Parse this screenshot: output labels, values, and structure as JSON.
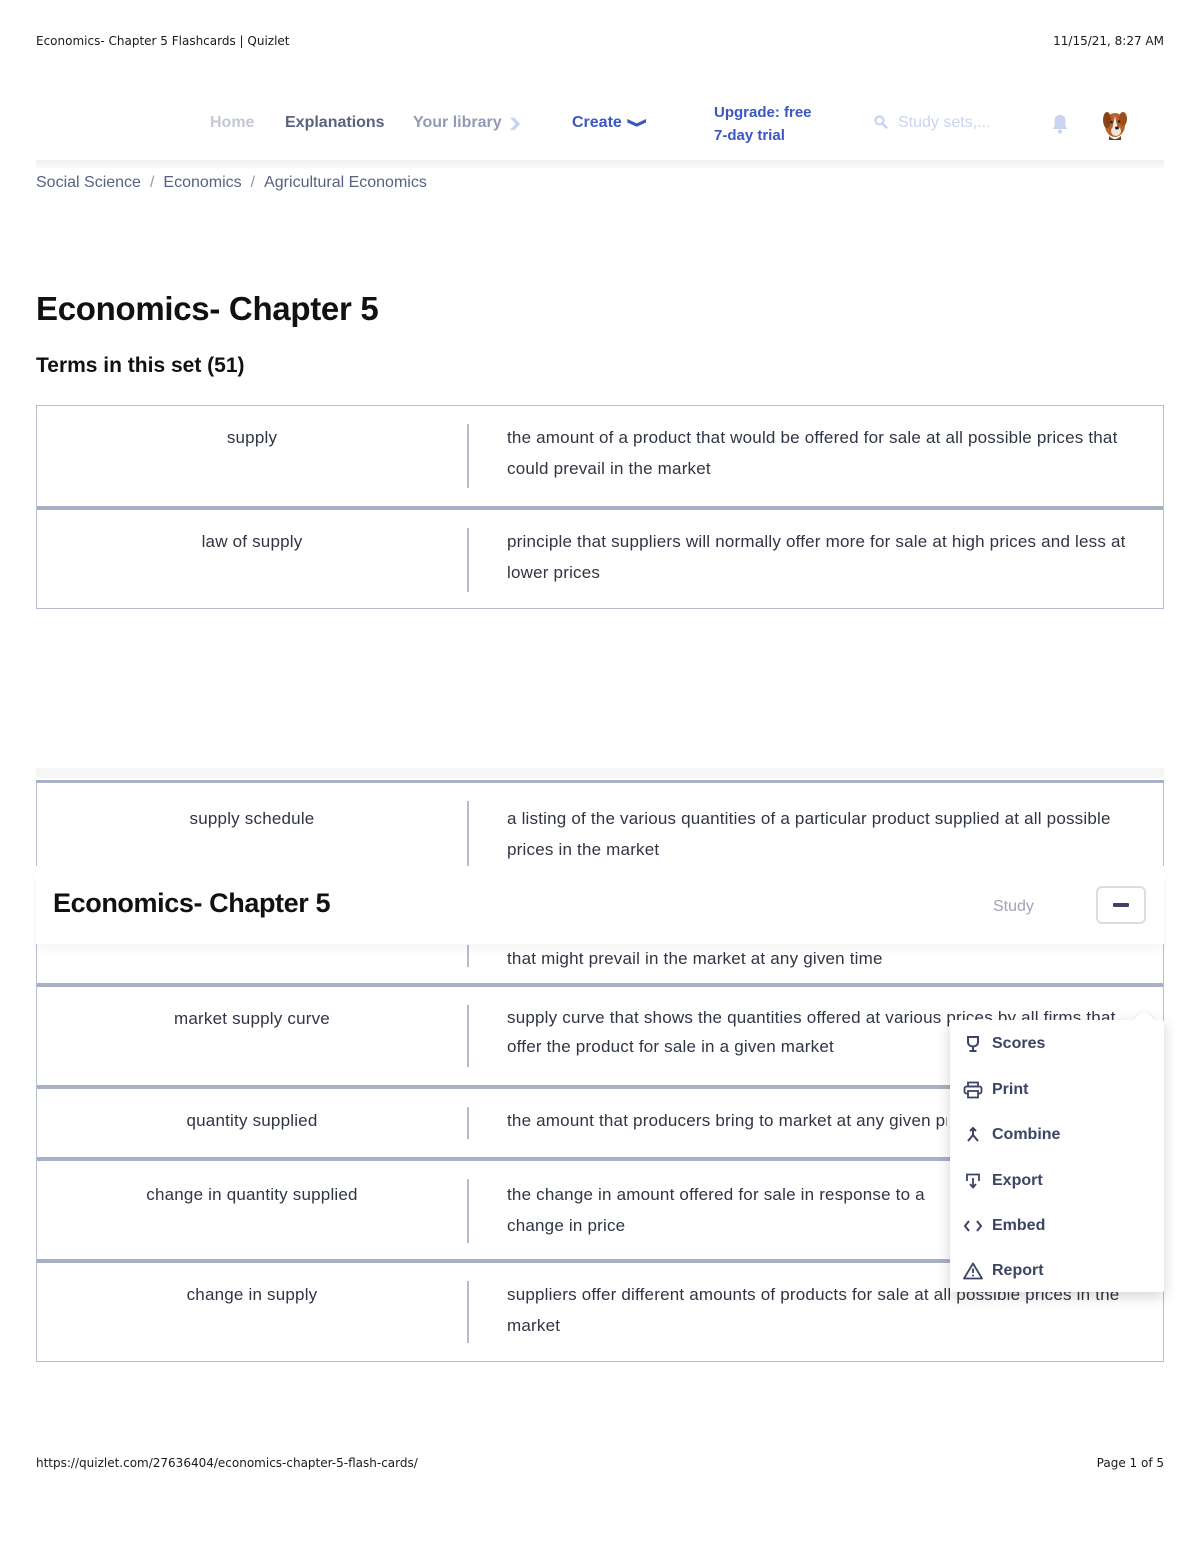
{
  "print_header": {
    "title": "Economics- Chapter 5 Flashcards | Quizlet",
    "datetime": "11/15/21, 8:27 AM"
  },
  "nav": {
    "home": "Home",
    "explanations": "Explanations",
    "your_library": "Your library",
    "create": "Create",
    "upgrade_line1": "Upgrade: free",
    "upgrade_line2": "7-day trial",
    "search_placeholder": "Study sets,...",
    "icons": {
      "search": "search-icon",
      "notifications": "bell-icon",
      "avatar": "dog-avatar"
    }
  },
  "breadcrumb": [
    "Social Science",
    "Economics",
    "Agricultural Economics"
  ],
  "breadcrumb_separator": "/",
  "set": {
    "title": "Economics- Chapter 5",
    "terms_heading": "Terms in this set (51)"
  },
  "terms_page1": [
    {
      "term": "supply",
      "definition": "the amount of a product that would be offered for sale at all possible prices that could prevail in the market"
    },
    {
      "term": "law of supply",
      "definition": "principle that suppliers will normally offer more for sale at high prices and less at lower prices"
    }
  ],
  "terms_page2": [
    {
      "term": "supply schedule",
      "definition": "a listing of the various quantities of a particular product supplied at all possible prices in the market"
    },
    {
      "term": "",
      "definition": "that might prevail in the market at any given time"
    },
    {
      "term": "market supply curve",
      "definition": "supply curve that shows the quantities offered at various prices by all firms that offer the product for sale in a given market"
    },
    {
      "term": "quantity supplied",
      "definition": "the amount that producers bring to market at any given price"
    },
    {
      "term": "change in quantity supplied",
      "definition": "the change in amount offered for sale in response to a change in price"
    },
    {
      "term": "change in supply",
      "definition": "suppliers offer different amounts of products for sale at all possible prices in the market"
    }
  ],
  "sticky_header": {
    "title": "Economics- Chapter 5",
    "study": "Study",
    "more_button": "more-options"
  },
  "menu": {
    "items": [
      {
        "label": "Scores",
        "icon": "trophy-icon"
      },
      {
        "label": "Print",
        "icon": "printer-icon"
      },
      {
        "label": "Combine",
        "icon": "combine-icon"
      },
      {
        "label": "Export",
        "icon": "export-icon"
      },
      {
        "label": "Embed",
        "icon": "embed-icon"
      },
      {
        "label": "Report",
        "icon": "warning-icon"
      }
    ]
  },
  "print_footer": {
    "url": "https://quizlet.com/27636404/economics-chapter-5-flash-cards/",
    "page": "Page 1 of 5"
  },
  "colors": {
    "brand_blue": "#3c57c4",
    "nav_gray": "#586380",
    "row_border": "#a8b0c6"
  }
}
